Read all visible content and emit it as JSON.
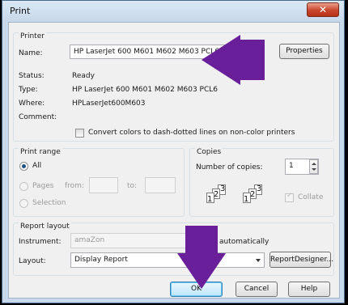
{
  "window": {
    "title": "Print",
    "close_icon": "close-icon"
  },
  "printer": {
    "group_label": "Printer",
    "name_label": "Name:",
    "name_value": "HP LaserJet 600 M601 M602 M603 PCL6",
    "properties_label": "Properties",
    "status_label": "Status:",
    "status_value": "Ready",
    "type_label": "Type:",
    "type_value": "HP LaserJet 600 M601 M602 M603 PCL6",
    "where_label": "Where:",
    "where_value": "HPLaserJet600M603",
    "comment_label": "Comment:",
    "convert_label": "Convert colors to dash-dotted lines on non-color printers",
    "convert_checked": false
  },
  "print_range": {
    "group_label": "Print range",
    "all_label": "All",
    "all_selected": true,
    "pages_label": "Pages",
    "from_label": "from:",
    "to_label": "to:",
    "selection_label": "Selection"
  },
  "copies": {
    "group_label": "Copies",
    "number_label": "Number of copies:",
    "number_value": "1",
    "collate_label": "Collate",
    "collate_checked": true,
    "page_numbers": [
      "1",
      "2",
      "3"
    ]
  },
  "report_layout": {
    "group_label": "Report layout",
    "instrument_label": "Instrument:",
    "instrument_value": "amaZon",
    "auto_label": "automatically",
    "layout_label": "Layout:",
    "layout_value": "Display Report",
    "designer_label": "ReportDesigner..."
  },
  "buttons": {
    "ok": "OK",
    "cancel": "Cancel",
    "help": "Help"
  },
  "colors": {
    "accent_arrow": "#6a1f9a",
    "title_bar": "#c9d9ec",
    "close_button": "#c8452b"
  }
}
